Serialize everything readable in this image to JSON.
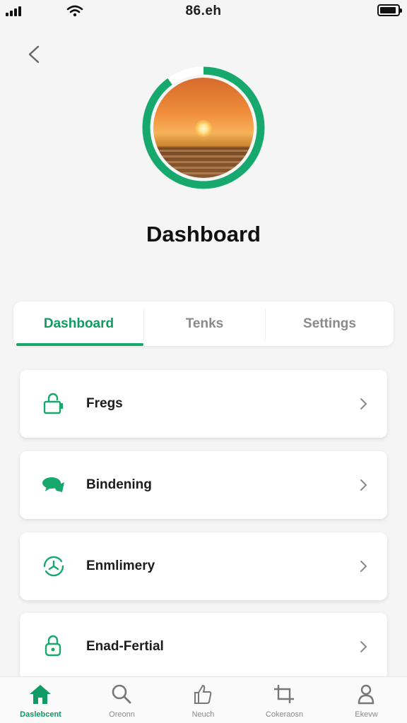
{
  "status_bar": {
    "time": "86.eh"
  },
  "header": {
    "title": "Dashboard"
  },
  "tabs": [
    {
      "label": "Dashboard",
      "active": true
    },
    {
      "label": "Tenks",
      "active": false
    },
    {
      "label": "Settings",
      "active": false
    }
  ],
  "menu": [
    {
      "label": "Fregs",
      "icon": "lock-icon"
    },
    {
      "label": "Bindening",
      "icon": "chat-bubble-icon"
    },
    {
      "label": "Enmlimery",
      "icon": "sync-clock-icon"
    },
    {
      "label": "Enad-Fertial",
      "icon": "padlock-icon"
    }
  ],
  "bottom_nav": [
    {
      "label": "Daslebcent",
      "icon": "home-icon",
      "active": true
    },
    {
      "label": "Oreonn",
      "icon": "search-icon",
      "active": false
    },
    {
      "label": "Neuch",
      "icon": "thumbs-up-icon",
      "active": false
    },
    {
      "label": "Cokeraosn",
      "icon": "crop-icon",
      "active": false
    },
    {
      "label": "Ekevw",
      "icon": "profile-icon",
      "active": false
    }
  ],
  "colors": {
    "accent": "#16a86c",
    "accent_text": "#129a63",
    "muted": "#8a8a8a",
    "background": "#f5f5f5"
  },
  "avatar": {
    "ring_progress": 0.9
  }
}
